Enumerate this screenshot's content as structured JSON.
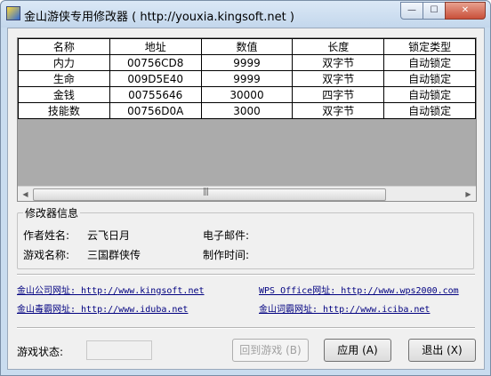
{
  "window": {
    "title": "金山游侠专用修改器 ( http://youxia.kingsoft.net )",
    "minimize_glyph": "—",
    "maximize_glyph": "☐",
    "close_glyph": "✕"
  },
  "table": {
    "columns": [
      "名称",
      "地址",
      "数值",
      "长度",
      "锁定类型"
    ],
    "rows": [
      [
        "内力",
        "00756CD8",
        "9999",
        "双字节",
        "自动锁定"
      ],
      [
        "生命",
        "009D5E40",
        "9999",
        "双字节",
        "自动锁定"
      ],
      [
        "金钱",
        "00755646",
        "30000",
        "四字节",
        "自动锁定"
      ],
      [
        "技能数",
        "00756D0A",
        "3000",
        "双字节",
        "自动锁定"
      ]
    ]
  },
  "info": {
    "legend": "修改器信息",
    "author_label": "作者姓名:",
    "author_value": "云飞日月",
    "email_label": "电子邮件:",
    "email_value": "",
    "game_label": "游戏名称:",
    "game_value": "三国群侠传",
    "time_label": "制作时间:",
    "time_value": ""
  },
  "links": {
    "kingsoft": "金山公司网址: http://www.kingsoft.net",
    "wps": "WPS Office网址: http://www.wps2000.com",
    "duba": "金山毒霸网址: http://www.iduba.net",
    "iciba": "金山词霸网址: http://www.iciba.net"
  },
  "footer": {
    "status_label": "游戏状态:",
    "status_value": "",
    "back_button": "回到游戏 (B)",
    "apply_button": "应用 (A)",
    "exit_button": "退出 (X)"
  }
}
